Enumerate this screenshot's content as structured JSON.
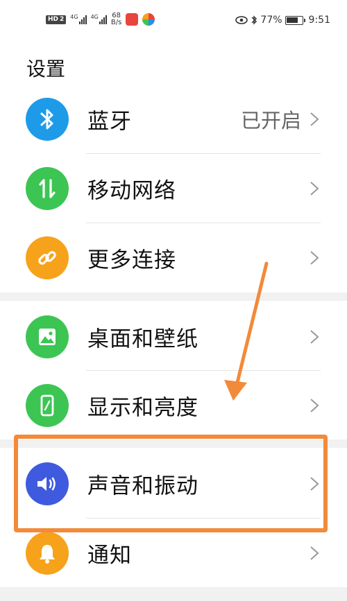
{
  "status_bar": {
    "hd_label": "HD",
    "sim_label": "2",
    "net_label_1": "4G",
    "net_label_2": "4G",
    "speed_value": "68",
    "speed_unit": "B/s",
    "battery_percent": "77%",
    "battery_level": 0.77,
    "time": "9:51"
  },
  "page": {
    "title": "设置"
  },
  "items": [
    {
      "label": "蓝牙",
      "value": "已开启",
      "icon": "bluetooth-icon",
      "color": "#1e9be8"
    },
    {
      "label": "移动网络",
      "value": "",
      "icon": "mobile-data-icon",
      "color": "#3cc553"
    },
    {
      "label": "更多连接",
      "value": "",
      "icon": "link-icon",
      "color": "#f7a21b"
    },
    {
      "label": "桌面和壁纸",
      "value": "",
      "icon": "image-icon",
      "color": "#3cc553"
    },
    {
      "label": "显示和亮度",
      "value": "",
      "icon": "phone-brightness-icon",
      "color": "#3cc553"
    },
    {
      "label": "声音和振动",
      "value": "",
      "icon": "speaker-icon",
      "color": "#3f5ade"
    },
    {
      "label": "通知",
      "value": "",
      "icon": "bell-icon",
      "color": "#f7a21b"
    }
  ],
  "colors": {
    "annotation": "#f28a3a",
    "separator": "#f1f1f1"
  }
}
